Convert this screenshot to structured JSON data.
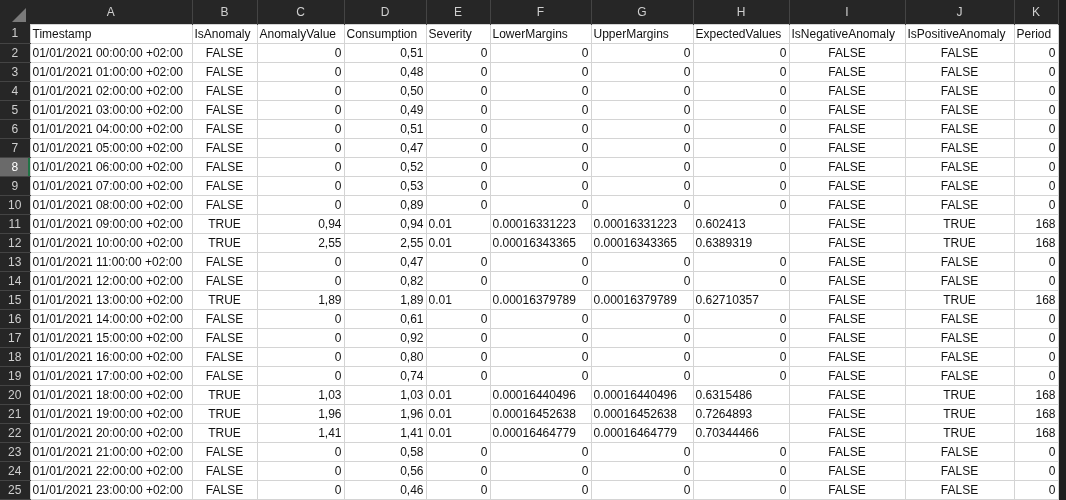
{
  "columns": [
    {
      "letter": "A",
      "kind": "text"
    },
    {
      "letter": "B",
      "kind": "bool"
    },
    {
      "letter": "C",
      "kind": "num"
    },
    {
      "letter": "D",
      "kind": "num"
    },
    {
      "letter": "E",
      "kind": "num"
    },
    {
      "letter": "F",
      "kind": "num"
    },
    {
      "letter": "G",
      "kind": "num"
    },
    {
      "letter": "H",
      "kind": "num"
    },
    {
      "letter": "I",
      "kind": "bool"
    },
    {
      "letter": "J",
      "kind": "bool"
    },
    {
      "letter": "K",
      "kind": "num"
    }
  ],
  "rows": [
    {
      "number": "1",
      "selected": false,
      "kind": "header",
      "cells": [
        "Timestamp",
        "IsAnomaly",
        "AnomalyValue",
        "Consumption",
        "Severity",
        "LowerMargins",
        "UpperMargins",
        "ExpectedValues",
        "IsNegativeAnomaly",
        "IsPositiveAnomaly",
        "Period"
      ]
    },
    {
      "number": "2",
      "selected": false,
      "kind": "normal",
      "cells": [
        "01/01/2021 00:00:00 +02:00",
        "FALSE",
        "0",
        "0,51",
        "0",
        "0",
        "0",
        "0",
        "FALSE",
        "FALSE",
        "0"
      ]
    },
    {
      "number": "3",
      "selected": false,
      "kind": "normal",
      "cells": [
        "01/01/2021 01:00:00 +02:00",
        "FALSE",
        "0",
        "0,48",
        "0",
        "0",
        "0",
        "0",
        "FALSE",
        "FALSE",
        "0"
      ]
    },
    {
      "number": "4",
      "selected": false,
      "kind": "normal",
      "cells": [
        "01/01/2021 02:00:00 +02:00",
        "FALSE",
        "0",
        "0,50",
        "0",
        "0",
        "0",
        "0",
        "FALSE",
        "FALSE",
        "0"
      ]
    },
    {
      "number": "5",
      "selected": false,
      "kind": "normal",
      "cells": [
        "01/01/2021 03:00:00 +02:00",
        "FALSE",
        "0",
        "0,49",
        "0",
        "0",
        "0",
        "0",
        "FALSE",
        "FALSE",
        "0"
      ]
    },
    {
      "number": "6",
      "selected": false,
      "kind": "normal",
      "cells": [
        "01/01/2021 04:00:00 +02:00",
        "FALSE",
        "0",
        "0,51",
        "0",
        "0",
        "0",
        "0",
        "FALSE",
        "FALSE",
        "0"
      ]
    },
    {
      "number": "7",
      "selected": false,
      "kind": "normal",
      "cells": [
        "01/01/2021 05:00:00 +02:00",
        "FALSE",
        "0",
        "0,47",
        "0",
        "0",
        "0",
        "0",
        "FALSE",
        "FALSE",
        "0"
      ]
    },
    {
      "number": "8",
      "selected": true,
      "kind": "normal",
      "cells": [
        "01/01/2021 06:00:00 +02:00",
        "FALSE",
        "0",
        "0,52",
        "0",
        "0",
        "0",
        "0",
        "FALSE",
        "FALSE",
        "0"
      ]
    },
    {
      "number": "9",
      "selected": false,
      "kind": "normal",
      "cells": [
        "01/01/2021 07:00:00 +02:00",
        "FALSE",
        "0",
        "0,53",
        "0",
        "0",
        "0",
        "0",
        "FALSE",
        "FALSE",
        "0"
      ]
    },
    {
      "number": "10",
      "selected": false,
      "kind": "normal",
      "cells": [
        "01/01/2021 08:00:00 +02:00",
        "FALSE",
        "0",
        "0,89",
        "0",
        "0",
        "0",
        "0",
        "FALSE",
        "FALSE",
        "0"
      ]
    },
    {
      "number": "11",
      "selected": false,
      "kind": "anomaly",
      "cells": [
        "01/01/2021 09:00:00 +02:00",
        "TRUE",
        "0,94",
        "0,94",
        "0.01",
        "0.00016331223",
        "0.00016331223",
        "0.602413",
        "FALSE",
        "TRUE",
        "168"
      ]
    },
    {
      "number": "12",
      "selected": false,
      "kind": "anomaly",
      "cells": [
        "01/01/2021 10:00:00 +02:00",
        "TRUE",
        "2,55",
        "2,55",
        "0.01",
        "0.00016343365",
        "0.00016343365",
        "0.6389319",
        "FALSE",
        "TRUE",
        "168"
      ]
    },
    {
      "number": "13",
      "selected": false,
      "kind": "normal",
      "cells": [
        "01/01/2021 11:00:00 +02:00",
        "FALSE",
        "0",
        "0,47",
        "0",
        "0",
        "0",
        "0",
        "FALSE",
        "FALSE",
        "0"
      ]
    },
    {
      "number": "14",
      "selected": false,
      "kind": "normal",
      "cells": [
        "01/01/2021 12:00:00 +02:00",
        "FALSE",
        "0",
        "0,82",
        "0",
        "0",
        "0",
        "0",
        "FALSE",
        "FALSE",
        "0"
      ]
    },
    {
      "number": "15",
      "selected": false,
      "kind": "anomaly",
      "cells": [
        "01/01/2021 13:00:00 +02:00",
        "TRUE",
        "1,89",
        "1,89",
        "0.01",
        "0.00016379789",
        "0.00016379789",
        "0.62710357",
        "FALSE",
        "TRUE",
        "168"
      ]
    },
    {
      "number": "16",
      "selected": false,
      "kind": "normal",
      "cells": [
        "01/01/2021 14:00:00 +02:00",
        "FALSE",
        "0",
        "0,61",
        "0",
        "0",
        "0",
        "0",
        "FALSE",
        "FALSE",
        "0"
      ]
    },
    {
      "number": "17",
      "selected": false,
      "kind": "normal",
      "cells": [
        "01/01/2021 15:00:00 +02:00",
        "FALSE",
        "0",
        "0,92",
        "0",
        "0",
        "0",
        "0",
        "FALSE",
        "FALSE",
        "0"
      ]
    },
    {
      "number": "18",
      "selected": false,
      "kind": "normal",
      "cells": [
        "01/01/2021 16:00:00 +02:00",
        "FALSE",
        "0",
        "0,80",
        "0",
        "0",
        "0",
        "0",
        "FALSE",
        "FALSE",
        "0"
      ]
    },
    {
      "number": "19",
      "selected": false,
      "kind": "normal",
      "cells": [
        "01/01/2021 17:00:00 +02:00",
        "FALSE",
        "0",
        "0,74",
        "0",
        "0",
        "0",
        "0",
        "FALSE",
        "FALSE",
        "0"
      ]
    },
    {
      "number": "20",
      "selected": false,
      "kind": "anomaly",
      "cells": [
        "01/01/2021 18:00:00 +02:00",
        "TRUE",
        "1,03",
        "1,03",
        "0.01",
        "0.00016440496",
        "0.00016440496",
        "0.6315486",
        "FALSE",
        "TRUE",
        "168"
      ]
    },
    {
      "number": "21",
      "selected": false,
      "kind": "anomaly",
      "cells": [
        "01/01/2021 19:00:00 +02:00",
        "TRUE",
        "1,96",
        "1,96",
        "0.01",
        "0.00016452638",
        "0.00016452638",
        "0.7264893",
        "FALSE",
        "TRUE",
        "168"
      ]
    },
    {
      "number": "22",
      "selected": false,
      "kind": "anomaly",
      "cells": [
        "01/01/2021 20:00:00 +02:00",
        "TRUE",
        "1,41",
        "1,41",
        "0.01",
        "0.00016464779",
        "0.00016464779",
        "0.70344466",
        "FALSE",
        "TRUE",
        "168"
      ]
    },
    {
      "number": "23",
      "selected": false,
      "kind": "normal",
      "cells": [
        "01/01/2021 21:00:00 +02:00",
        "FALSE",
        "0",
        "0,58",
        "0",
        "0",
        "0",
        "0",
        "FALSE",
        "FALSE",
        "0"
      ]
    },
    {
      "number": "24",
      "selected": false,
      "kind": "normal",
      "cells": [
        "01/01/2021 22:00:00 +02:00",
        "FALSE",
        "0",
        "0,56",
        "0",
        "0",
        "0",
        "0",
        "FALSE",
        "FALSE",
        "0"
      ]
    },
    {
      "number": "25",
      "selected": false,
      "kind": "normal",
      "cells": [
        "01/01/2021 23:00:00 +02:00",
        "FALSE",
        "0",
        "0,46",
        "0",
        "0",
        "0",
        "0",
        "FALSE",
        "FALSE",
        "0"
      ]
    }
  ]
}
